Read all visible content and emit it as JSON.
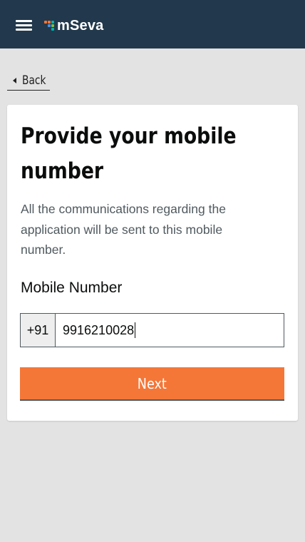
{
  "header": {
    "brand": "mSeva",
    "menu_icon": "hamburger-menu-icon",
    "background_color": "#22394d"
  },
  "back_link": {
    "label": "Back",
    "icon": "caret-left-icon"
  },
  "form": {
    "title": "Provide your mobile number",
    "description": "All the communications regarding the application will be sent to this mobile number.",
    "mobile_label": "Mobile Number",
    "country_code": "+91",
    "mobile_value": "9916210028",
    "submit_label": "Next",
    "submit_color": "#f47738"
  }
}
